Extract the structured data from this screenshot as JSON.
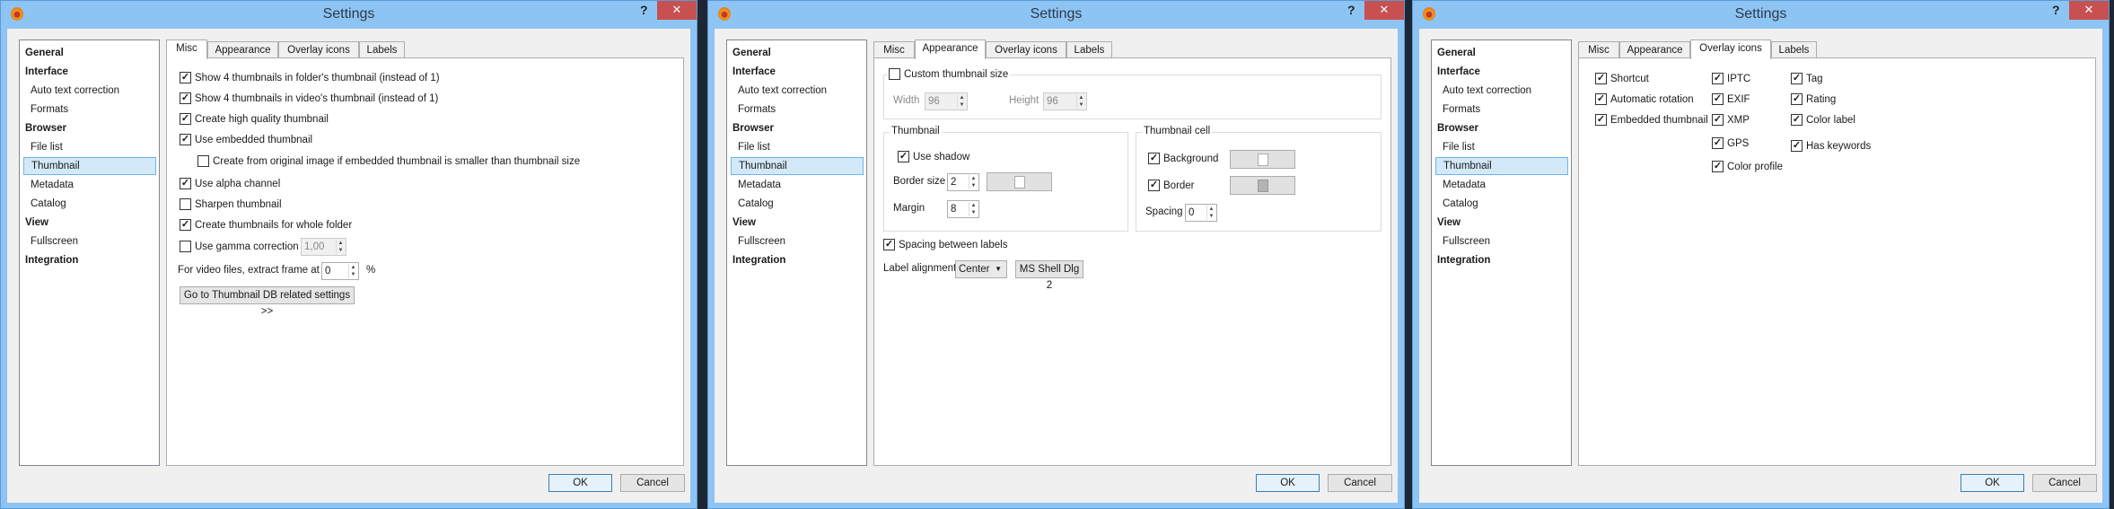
{
  "window": {
    "title": "Settings",
    "help_label": "?",
    "close_label": "✕",
    "app_icon": "app-logo-icon",
    "close_icon": "close-icon"
  },
  "sidebar": {
    "items": [
      {
        "label": "General",
        "level": "header"
      },
      {
        "label": "Interface",
        "level": "header"
      },
      {
        "label": "Auto text correction",
        "level": "sub"
      },
      {
        "label": "Formats",
        "level": "sub"
      },
      {
        "label": "Browser",
        "level": "header"
      },
      {
        "label": "File list",
        "level": "sub"
      },
      {
        "label": "Thumbnail",
        "level": "sub",
        "selected": true
      },
      {
        "label": "Metadata",
        "level": "sub"
      },
      {
        "label": "Catalog",
        "level": "sub"
      },
      {
        "label": "View",
        "level": "header"
      },
      {
        "label": "Fullscreen",
        "level": "sub"
      },
      {
        "label": "Integration",
        "level": "header"
      }
    ]
  },
  "tabs": [
    "Misc",
    "Appearance",
    "Overlay icons",
    "Labels"
  ],
  "buttons": {
    "ok": "OK",
    "cancel": "Cancel"
  },
  "dialogs": [
    {
      "active_tab": "Misc"
    },
    {
      "active_tab": "Appearance"
    },
    {
      "active_tab": "Overlay icons"
    }
  ],
  "misc": {
    "checkboxes": [
      {
        "label": "Show 4 thumbnails in folder's thumbnail (instead of 1)",
        "checked": true
      },
      {
        "label": "Show 4 thumbnails in video's thumbnail (instead of 1)",
        "checked": true
      },
      {
        "label": "Create high quality thumbnail",
        "checked": true
      },
      {
        "label": "Use embedded thumbnail",
        "checked": true
      },
      {
        "label": "Create from original image if embedded thumbnail is smaller than thumbnail size",
        "checked": false
      },
      {
        "label": "Use alpha channel",
        "checked": true
      },
      {
        "label": "Sharpen thumbnail",
        "checked": false
      },
      {
        "label": "Create  thumbnails for whole folder",
        "checked": true
      },
      {
        "label": "Use gamma correction",
        "checked": false
      }
    ],
    "gamma_value": "1,00",
    "video_frame_label": "For video files, extract frame at",
    "video_frame_value": "0",
    "video_frame_unit": "%",
    "db_button": "Go to Thumbnail DB related settings >>"
  },
  "appearance": {
    "custom_size": {
      "label": "Custom thumbnail size",
      "checked": false,
      "width_label": "Width",
      "width": "96",
      "height_label": "Height",
      "height": "96"
    },
    "thumbnail": {
      "title": "Thumbnail",
      "use_shadow": "Use shadow",
      "use_shadow_checked": true,
      "border_size_label": "Border size",
      "border_size": "2",
      "border_color": "#ffffff",
      "margin_label": "Margin",
      "margin": "8"
    },
    "cell": {
      "title": "Thumbnail cell",
      "background": "Background",
      "background_checked": true,
      "background_color": "#ffffff",
      "border": "Border",
      "border_checked": true,
      "border_color": "#b4b4b4",
      "spacing_label": "Spacing",
      "spacing": "0"
    },
    "spacing_between_labels": "Spacing between labels",
    "spacing_between_labels_checked": true,
    "label_alignment_label": "Label alignment",
    "label_alignment": "Center",
    "font_button": "MS Shell Dlg 2"
  },
  "overlay": {
    "checkboxes": [
      {
        "label": "Shortcut",
        "checked": true
      },
      {
        "label": "Automatic rotation",
        "checked": true
      },
      {
        "label": "Embedded thumbnail",
        "checked": true
      },
      {
        "label": "IPTC",
        "checked": true
      },
      {
        "label": "EXIF",
        "checked": true
      },
      {
        "label": "XMP",
        "checked": true
      },
      {
        "label": "GPS",
        "checked": true
      },
      {
        "label": "Color profile",
        "checked": true
      },
      {
        "label": "Tag",
        "checked": true
      },
      {
        "label": "Rating",
        "checked": true
      },
      {
        "label": "Color label",
        "checked": true
      },
      {
        "label": "Has keywords",
        "checked": true
      }
    ]
  },
  "colors": {
    "titlebar": "#8ec4f4",
    "close": "#c75050",
    "selection": "#d3e9f9"
  }
}
